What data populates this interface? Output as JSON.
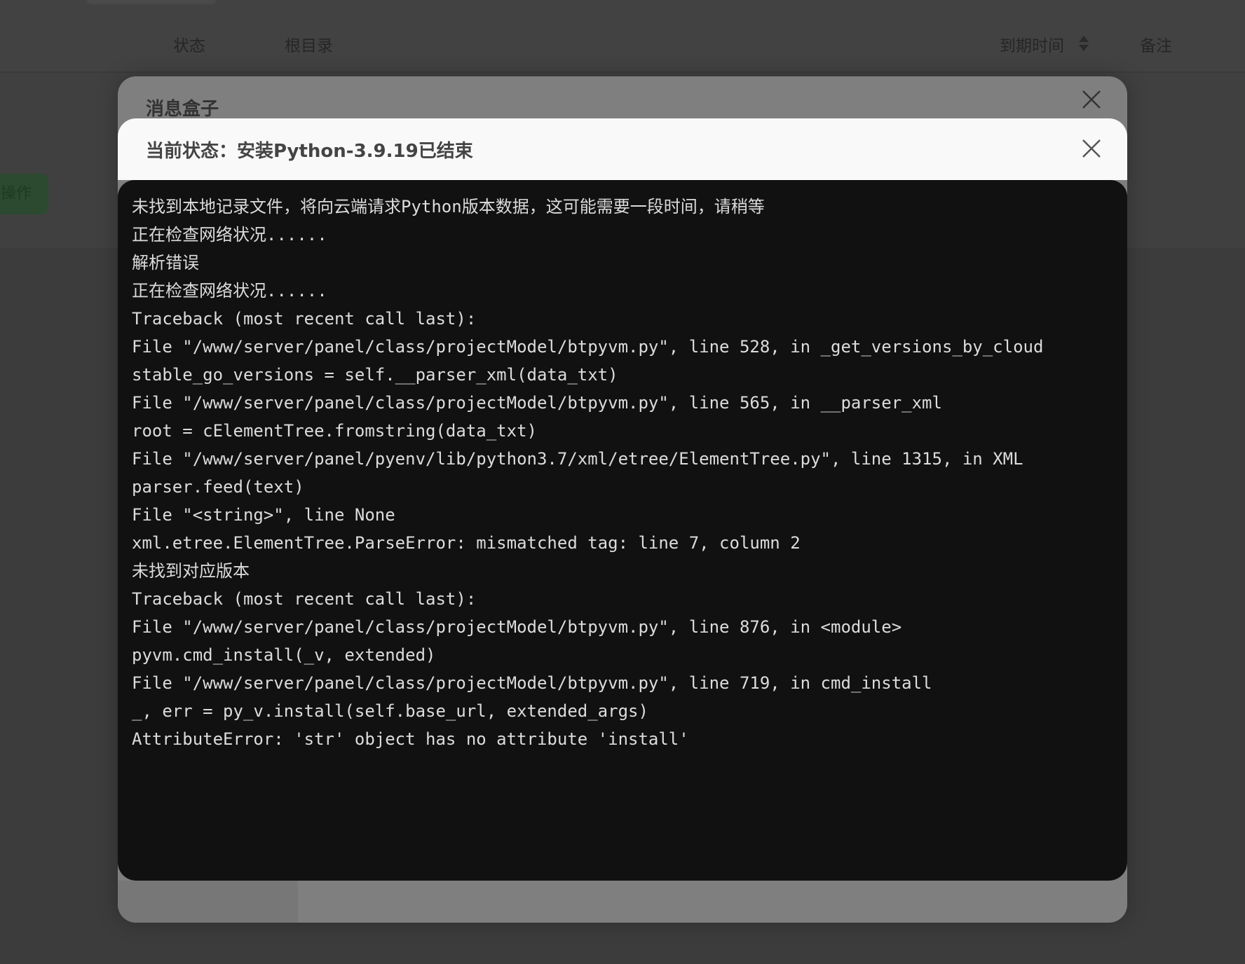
{
  "background_table": {
    "headers": [
      "状态",
      "根目录",
      "到期时间",
      "备注"
    ],
    "action_button": "操作"
  },
  "message_box": {
    "title": "消息盒子"
  },
  "status_dialog": {
    "title": "当前状态：安装Python-3.9.19已结束",
    "log_lines": [
      "未找到本地记录文件，将向云端请求Python版本数据，这可能需要一段时间，请稍等",
      "正在检查网络状况......",
      "解析错误",
      "正在检查网络状况......",
      "Traceback (most recent call last):",
      "File \"/www/server/panel/class/projectModel/btpyvm.py\", line 528, in _get_versions_by_cloud",
      "stable_go_versions = self.__parser_xml(data_txt)",
      "File \"/www/server/panel/class/projectModel/btpyvm.py\", line 565, in __parser_xml",
      "root = cElementTree.fromstring(data_txt)",
      "File \"/www/server/panel/pyenv/lib/python3.7/xml/etree/ElementTree.py\", line 1315, in XML",
      "parser.feed(text)",
      "File \"<string>\", line None",
      "xml.etree.ElementTree.ParseError: mismatched tag: line 7, column 2",
      "未找到对应版本",
      "Traceback (most recent call last):",
      "File \"/www/server/panel/class/projectModel/btpyvm.py\", line 876, in <module>",
      "pyvm.cmd_install(_v, extended)",
      "File \"/www/server/panel/class/projectModel/btpyvm.py\", line 719, in cmd_install",
      "_, err = py_v.install(self.base_url, extended_args)",
      "AttributeError: 'str' object has no attribute 'install'"
    ]
  }
}
